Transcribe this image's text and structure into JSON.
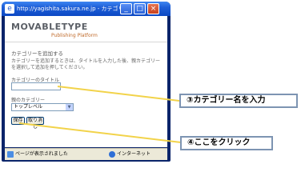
{
  "window": {
    "title": "http://yagishita.sakura.ne.jp - カテゴリーを追加...",
    "controls": {
      "minimize": "_",
      "maximize": "□",
      "close": "×"
    }
  },
  "logo": {
    "wordmark": "MOVABLETYPE",
    "subtitle": "Publishing Platform"
  },
  "page": {
    "heading": "カテゴリーを追加する",
    "description": "カテゴリーを追加するときは、タイトルを入力した後、親カテゴリーを選択して追加を押してください。",
    "title_label": "カテゴリーのタイトル",
    "title_value": "",
    "parent_label": "親のカテゴリー",
    "parent_selected": "トップレベル",
    "save_button": "保存",
    "cancel_button": "取り消し"
  },
  "statusbar": {
    "status": "ページが表示されました",
    "zone": "インターネット"
  },
  "annotations": {
    "step3": "③カテゴリー名を入力",
    "step4": "④ここをクリック"
  },
  "colors": {
    "callout_border": "#7d94b2",
    "leader_line": "#f2d34a",
    "titlebar": "#0b48c4"
  }
}
